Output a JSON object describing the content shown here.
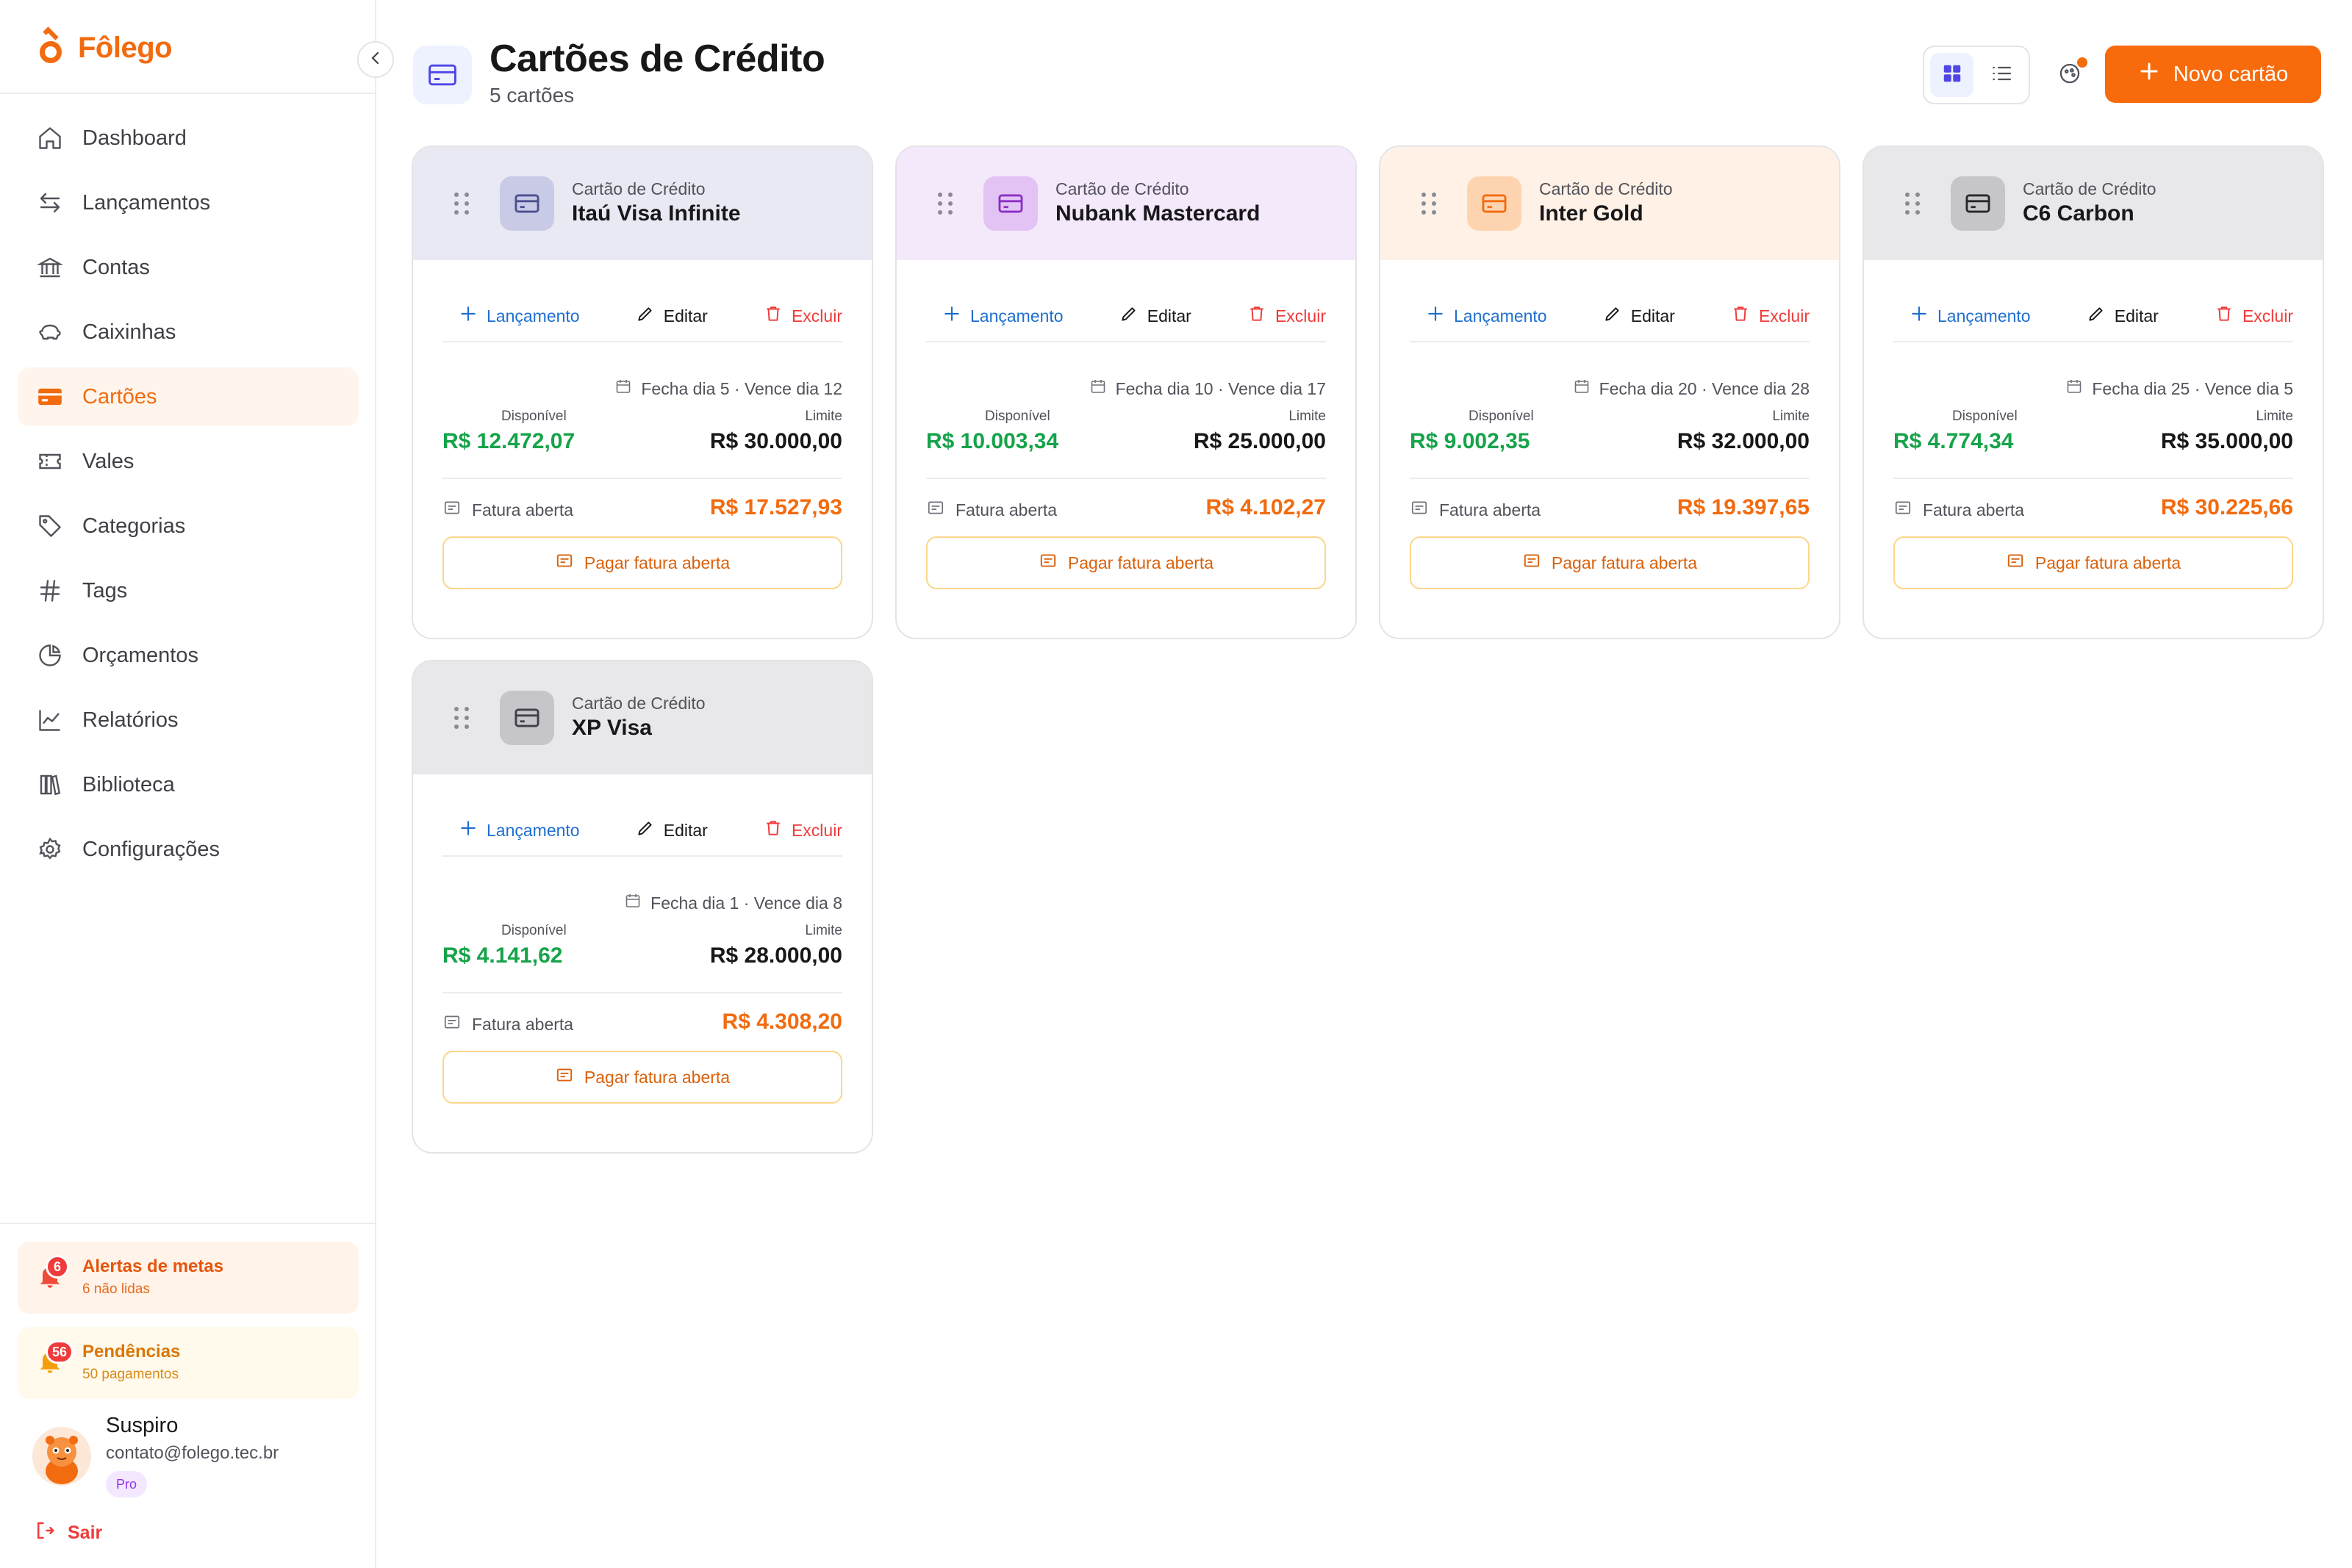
{
  "brand": {
    "name": "Fôlego"
  },
  "nav": [
    {
      "label": "Dashboard",
      "icon": "home-icon"
    },
    {
      "label": "Lançamentos",
      "icon": "arrows-exchange-icon"
    },
    {
      "label": "Contas",
      "icon": "bank-icon"
    },
    {
      "label": "Caixinhas",
      "icon": "piggy-bank-icon"
    },
    {
      "label": "Cartões",
      "icon": "credit-card-icon",
      "active": true
    },
    {
      "label": "Vales",
      "icon": "ticket-icon"
    },
    {
      "label": "Categorias",
      "icon": "tag-icon"
    },
    {
      "label": "Tags",
      "icon": "hash-icon"
    },
    {
      "label": "Orçamentos",
      "icon": "pie-chart-icon"
    },
    {
      "label": "Relatórios",
      "icon": "line-chart-icon"
    },
    {
      "label": "Biblioteca",
      "icon": "books-icon"
    },
    {
      "label": "Configurações",
      "icon": "gear-icon"
    }
  ],
  "alerts": {
    "metas": {
      "title": "Alertas de metas",
      "sub": "6 não lidas",
      "count": "6"
    },
    "pendencias": {
      "title": "Pendências",
      "sub": "50 pagamentos",
      "count": "56"
    }
  },
  "user": {
    "name": "Suspiro",
    "email": "contato@folego.tec.br",
    "plan": "Pro"
  },
  "logout_label": "Sair",
  "header": {
    "title": "Cartões de Crédito",
    "subtitle": "5 cartões",
    "new_button": "Novo cartão"
  },
  "colors": {
    "accent": "#f76b0c",
    "available": "#16a34a",
    "danger": "#ef3b3b",
    "link": "#1e6fd0"
  },
  "card_labels": {
    "type": "Cartão de Crédito",
    "lancamento": "Lançamento",
    "editar": "Editar",
    "excluir": "Excluir",
    "disponivel": "Disponível",
    "limite": "Limite",
    "fatura_aberta": "Fatura aberta",
    "pagar": "Pagar fatura aberta"
  },
  "cards": [
    {
      "name": "Itaú Visa Infinite",
      "dates": "Fecha dia 5 · Vence dia 12",
      "disponivel": "R$ 12.472,07",
      "limite": "R$ 30.000,00",
      "fatura": "R$ 17.527,93",
      "head_color": "#e9e9f3",
      "icon_bg": "#c9cae6",
      "icon_color": "#4b4f8f"
    },
    {
      "name": "Nubank Mastercard",
      "dates": "Fecha dia 10 · Vence dia 17",
      "disponivel": "R$ 10.003,34",
      "limite": "R$ 25.000,00",
      "fatura": "R$ 4.102,27",
      "head_color": "#f4e8fb",
      "icon_bg": "#e2c3f4",
      "icon_color": "#8a2fc2"
    },
    {
      "name": "Inter Gold",
      "dates": "Fecha dia 20 · Vence dia 28",
      "disponivel": "R$ 9.002,35",
      "limite": "R$ 32.000,00",
      "fatura": "R$ 19.397,65",
      "head_color": "#fff1e6",
      "icon_bg": "#fed4b0",
      "icon_color": "#f26b0f"
    },
    {
      "name": "C6 Carbon",
      "dates": "Fecha dia 25 · Vence dia 5",
      "disponivel": "R$ 4.774,34",
      "limite": "R$ 35.000,00",
      "fatura": "R$ 30.225,66",
      "head_color": "#e8e8ea",
      "icon_bg": "#c6c6ca",
      "icon_color": "#27272a"
    },
    {
      "name": "XP Visa",
      "dates": "Fecha dia 1 · Vence dia 8",
      "disponivel": "R$ 4.141,62",
      "limite": "R$ 28.000,00",
      "fatura": "R$ 4.308,20",
      "head_color": "#e8e8ea",
      "icon_bg": "#c6c6ca",
      "icon_color": "#3f3f46"
    }
  ]
}
